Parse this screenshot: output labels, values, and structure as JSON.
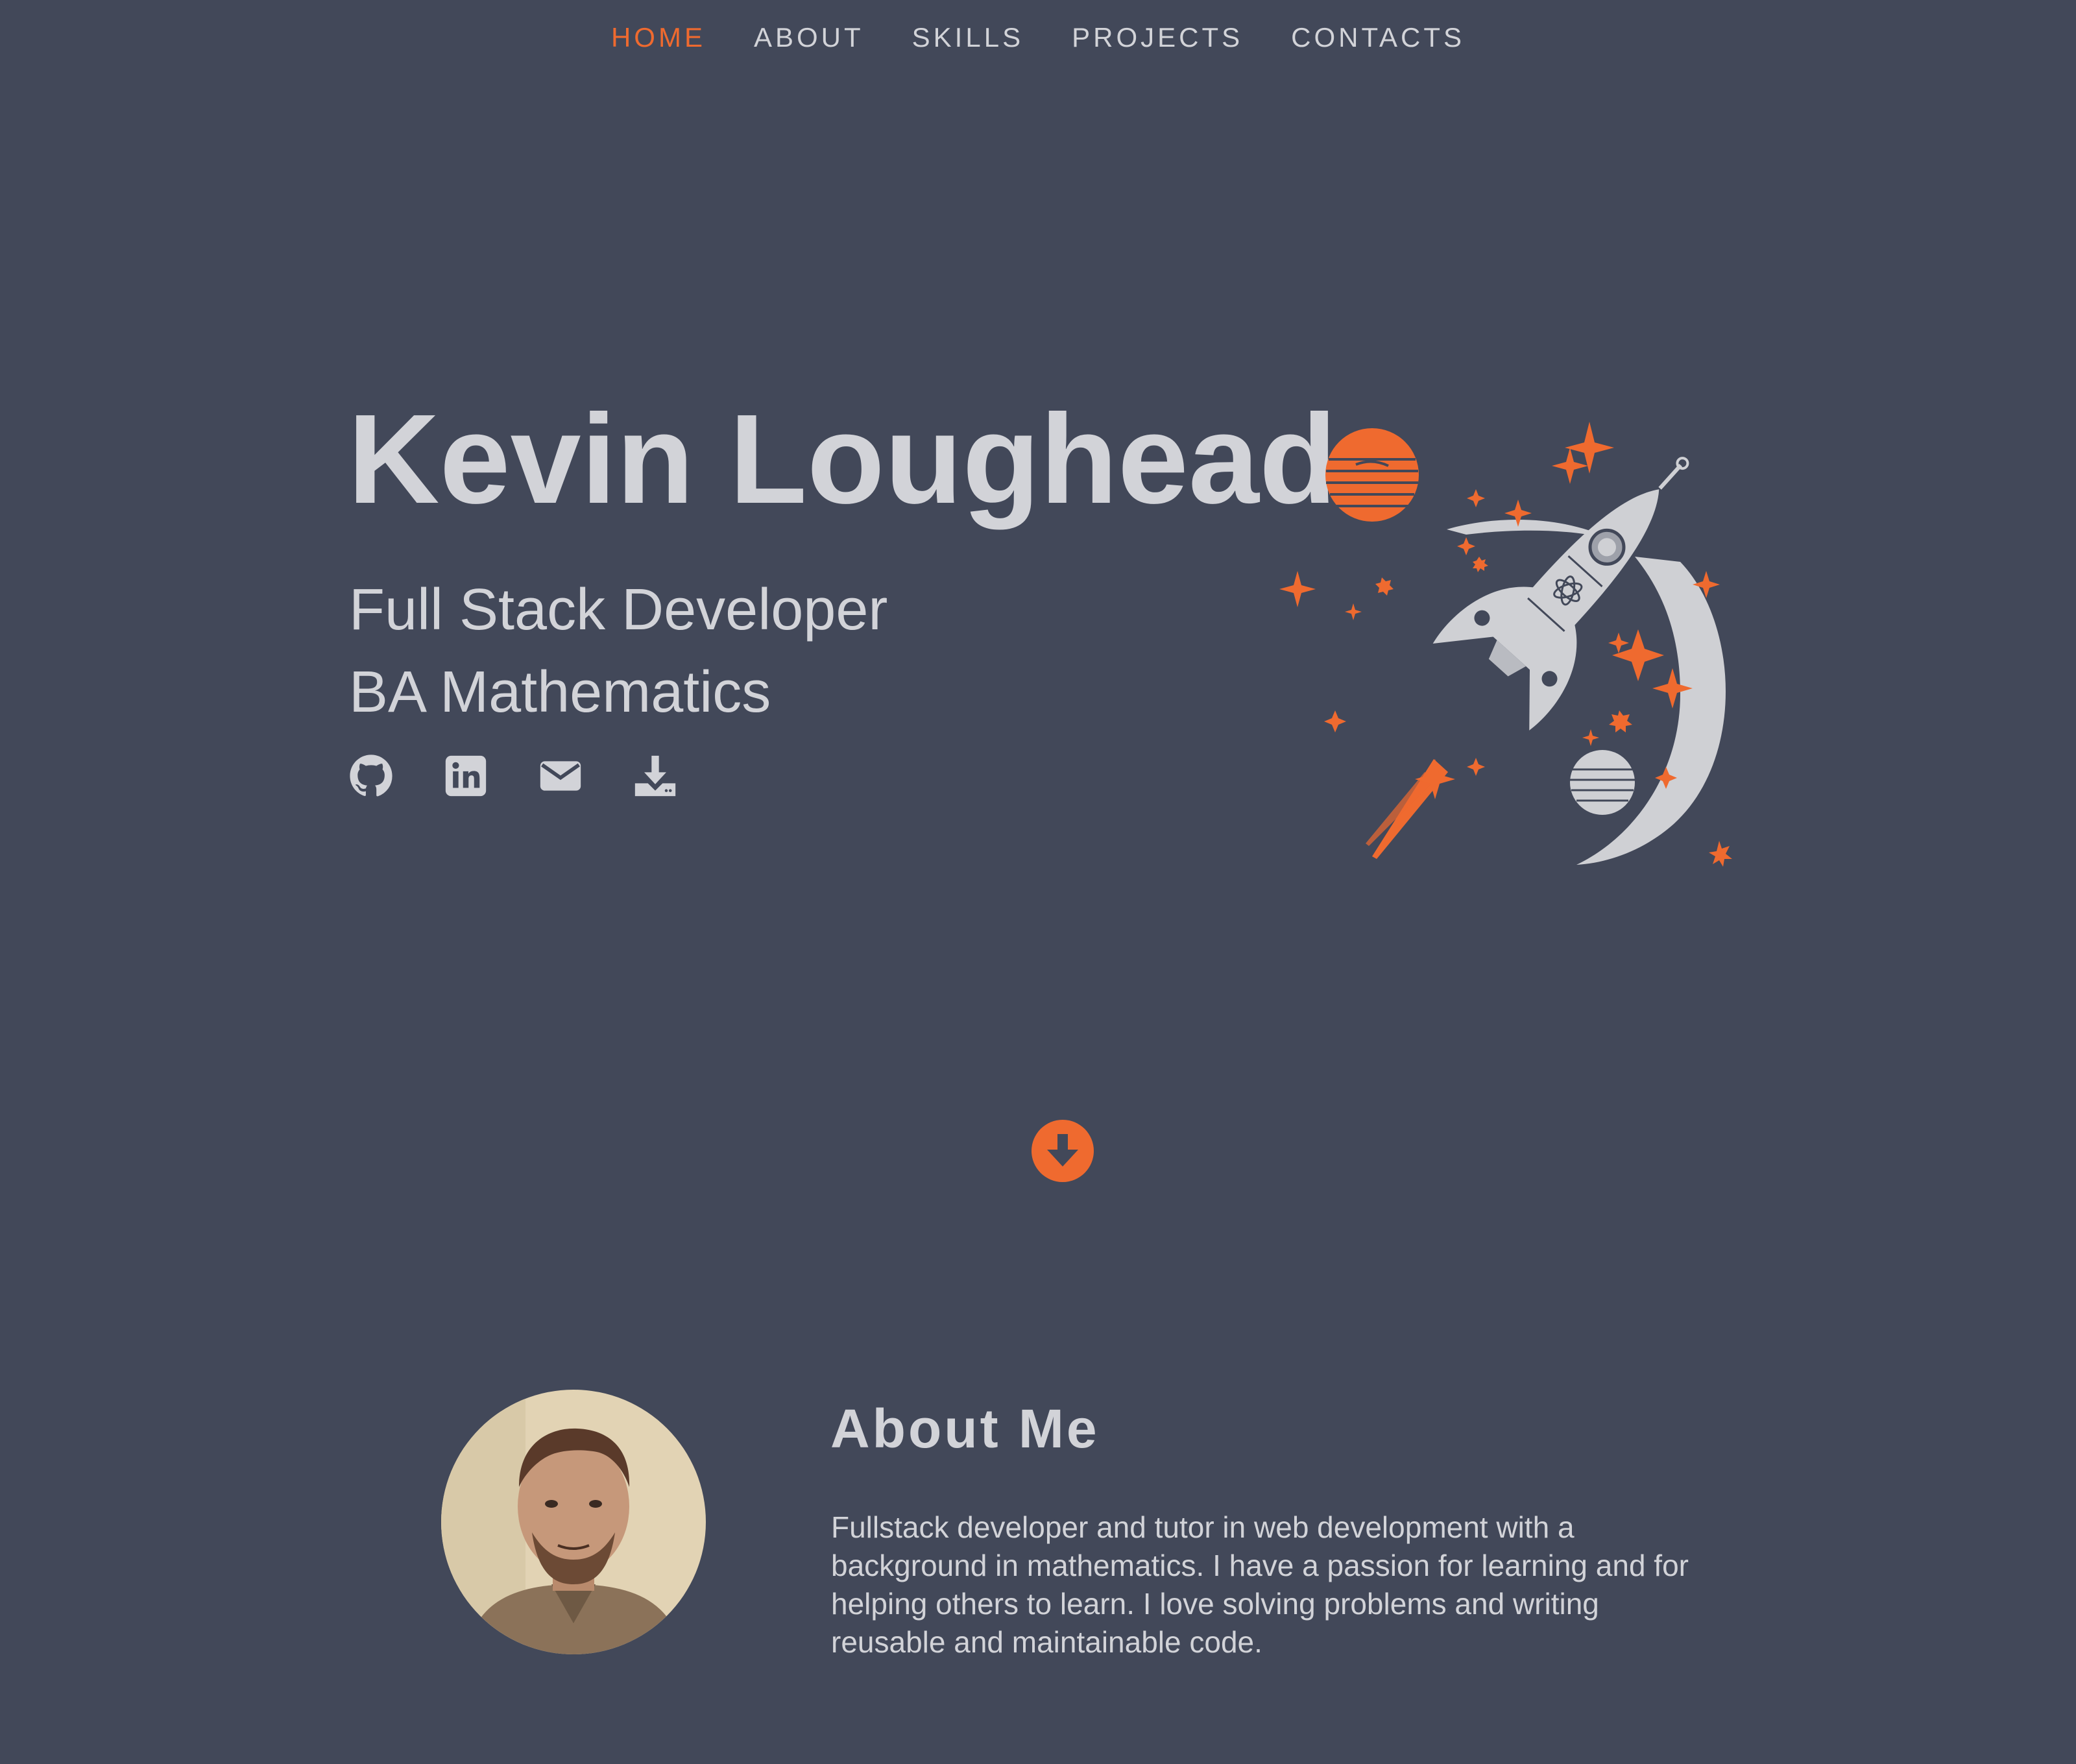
{
  "nav": {
    "items": [
      {
        "label": "HOME",
        "active": true
      },
      {
        "label": "ABOUT",
        "active": false
      },
      {
        "label": "SKILLS",
        "active": false
      },
      {
        "label": "PROJECTS",
        "active": false
      },
      {
        "label": "CONTACTS",
        "active": false
      }
    ]
  },
  "hero": {
    "name": "Kevin Loughead",
    "subtitle_1": "Full Stack Developer",
    "subtitle_2": "BA Mathematics",
    "social_icons": [
      "github-icon",
      "linkedin-icon",
      "email-icon",
      "download-icon"
    ]
  },
  "about": {
    "title": "About Me",
    "text": "Fullstack developer and tutor in web development with a background in mathematics. I have a passion for learning and for helping others to learn. I love solving problems and writing reusable and maintainable code."
  },
  "colors": {
    "background": "#424859",
    "text": "#d2d3d8",
    "accent": "#ef6a2f"
  }
}
